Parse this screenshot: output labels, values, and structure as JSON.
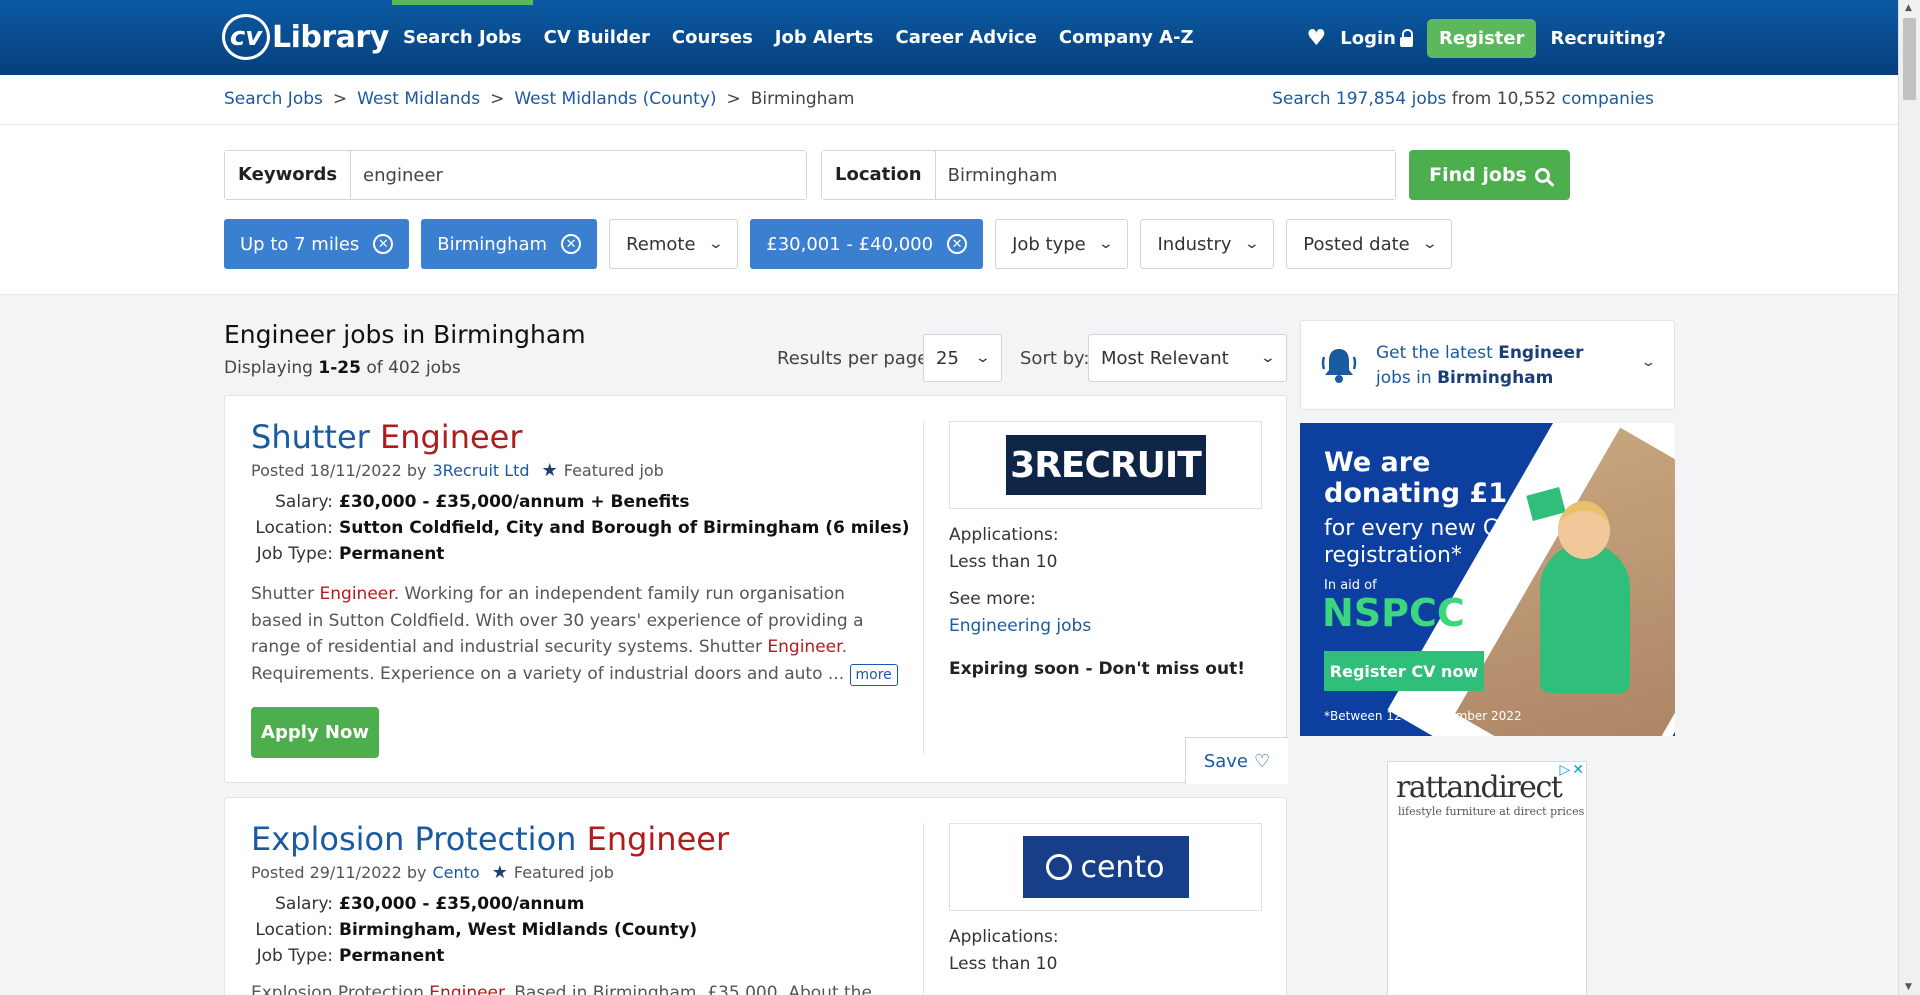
{
  "header": {
    "logo": "CV Library",
    "nav": [
      "Search Jobs",
      "CV Builder",
      "Courses",
      "Job Alerts",
      "Career Advice",
      "Company A-Z"
    ],
    "login": "Login",
    "register": "Register",
    "recruiting": "Recruiting?"
  },
  "breadcrumb": {
    "items": [
      "Search Jobs",
      "West Midlands",
      "West Midlands (County)"
    ],
    "current": "Birmingham",
    "sep": ">"
  },
  "jobcount": {
    "prefix": "Search",
    "jobs": "197,854 jobs",
    "middle": "from",
    "companies_num": "10,552",
    "companies": "companies"
  },
  "search": {
    "keywords_label": "Keywords",
    "keywords_value": "engineer",
    "location_label": "Location",
    "location_value": "Birmingham",
    "find_button": "Find jobs"
  },
  "filters": {
    "miles": "Up to 7 miles",
    "location": "Birmingham",
    "remote": "Remote",
    "salary": "£30,001 - £40,000",
    "job_type": "Job type",
    "industry": "Industry",
    "posted_date": "Posted date"
  },
  "results": {
    "title": "Engineer jobs in Birmingham",
    "displaying": "Displaying",
    "range": "1-25",
    "of": "of 402 jobs",
    "per_page_label": "Results per page:",
    "per_page_value": "25",
    "sort_label": "Sort by:",
    "sort_value": "Most Relevant"
  },
  "jobs": [
    {
      "title_pre": "Shutter",
      "title_kw": "Engineer",
      "posted": "Posted 18/11/2022 by",
      "company": "3Recruit Ltd",
      "featured": "Featured job",
      "salary_label": "Salary:",
      "salary": "£30,000 - £35,000/annum + Benefits",
      "location_label": "Location:",
      "location": "Sutton Coldfield, City and Borough of Birmingham (6 miles)",
      "type_label": "Job Type:",
      "type": "Permanent",
      "desc_1": "Shutter",
      "desc_kw1": "Engineer",
      "desc_2": ". Working for an independent family run organisation based in Sutton Coldfield. With over 30 years' experience of providing a range of residential and industrial security systems. Shutter",
      "desc_kw2": "Engineer",
      "desc_3": ". Requirements. Experience on a variety of industrial doors and auto ...",
      "more": "more",
      "apply": "Apply Now",
      "logo_text": "3RECRUIT",
      "applications_label": "Applications:",
      "applications": "Less than 10",
      "see_more_label": "See more:",
      "see_more_link": "Engineering jobs",
      "expiring": "Expiring soon - Don't miss out!",
      "save": "Save"
    },
    {
      "title_pre": "Explosion Protection",
      "title_kw": "Engineer",
      "posted": "Posted 29/11/2022 by",
      "company": "Cento",
      "featured": "Featured job",
      "salary_label": "Salary:",
      "salary": "£30,000 - £35,000/annum",
      "location_label": "Location:",
      "location": "Birmingham, West Midlands (County)",
      "type_label": "Job Type:",
      "type": "Permanent",
      "desc_1": "Explosion Protection",
      "desc_kw1": "Engineer",
      "desc_2": ". Based in Birmingham. £35,000. About the",
      "logo_text": "cento",
      "applications_label": "Applications:",
      "applications": "Less than 10"
    }
  ],
  "alert": {
    "pre": "Get the latest",
    "kw": "Engineer",
    "mid": "jobs in",
    "loc": "Birmingham"
  },
  "ad_nspcc": {
    "line1": "We are",
    "line2": "donating £1",
    "line3": "for every new CV registration*",
    "aid": "In aid of",
    "brand": "NSPCC",
    "button": "Register CV now",
    "note": "*Between 12-18 December 2022"
  },
  "ad_rattan": {
    "brand": "rattandirect",
    "tagline": "lifestyle furniture at direct prices"
  },
  "colors": {
    "header_blue": "#063f7c",
    "accent_green": "#4cae4c",
    "chip_blue": "#3a7fd0",
    "link_blue": "#1a5aa0",
    "keyword_red": "#b01c1c"
  }
}
